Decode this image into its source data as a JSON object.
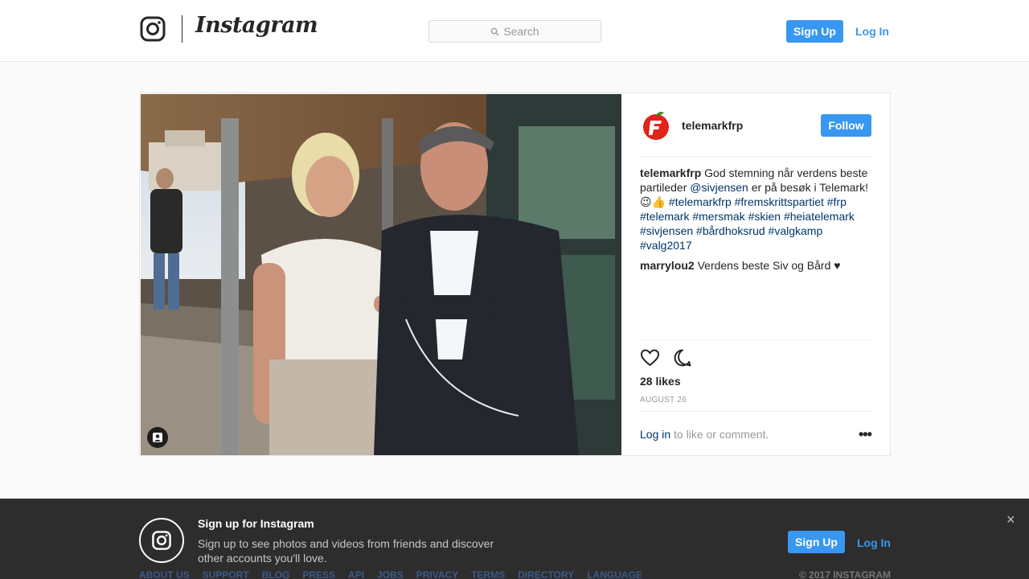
{
  "header": {
    "wordmark": "Instagram",
    "search_placeholder": "Search",
    "signup_label": "Sign Up",
    "login_label": "Log In"
  },
  "post": {
    "username": "telemarkfrp",
    "follow_label": "Follow",
    "caption_user": "telemarkfrp",
    "caption_parts": {
      "text1": "God stemning når verdens beste partileder",
      "mention": "@sivjensen",
      "text2": "er på besøk i Telemark!",
      "emoji": "😉👍",
      "tags_line1": "#telemarkfrp #fremskrittspartiet #frp",
      "tags_line2": "#telemark #mersmak #skien #heiatelemark",
      "tags_line3": "#sivjensen #bårdhoksrud #valgkamp",
      "tags_line4": "#valg2017"
    },
    "comment": {
      "user": "marrylou2",
      "text": "Verdens beste Siv og Bård ♥"
    },
    "likes": "28 likes",
    "date": "AUGUST 26",
    "login_link": "Log in",
    "login_suffix": "to like or comment.",
    "more_icon": "•••"
  },
  "banner": {
    "title": "Sign up for Instagram",
    "text": "Sign up to see photos and videos from friends and discover other accounts you'll love.",
    "signup_label": "Sign Up",
    "login_label": "Log In",
    "close": "×"
  },
  "footer": {
    "links": [
      "ABOUT US",
      "SUPPORT",
      "BLOG",
      "PRESS",
      "API",
      "JOBS",
      "PRIVACY",
      "TERMS",
      "DIRECTORY",
      "LANGUAGE"
    ],
    "copyright": "© 2017 INSTAGRAM"
  },
  "colors": {
    "accent": "#3897f0",
    "link": "#003569",
    "banner_bg": "#262626"
  }
}
